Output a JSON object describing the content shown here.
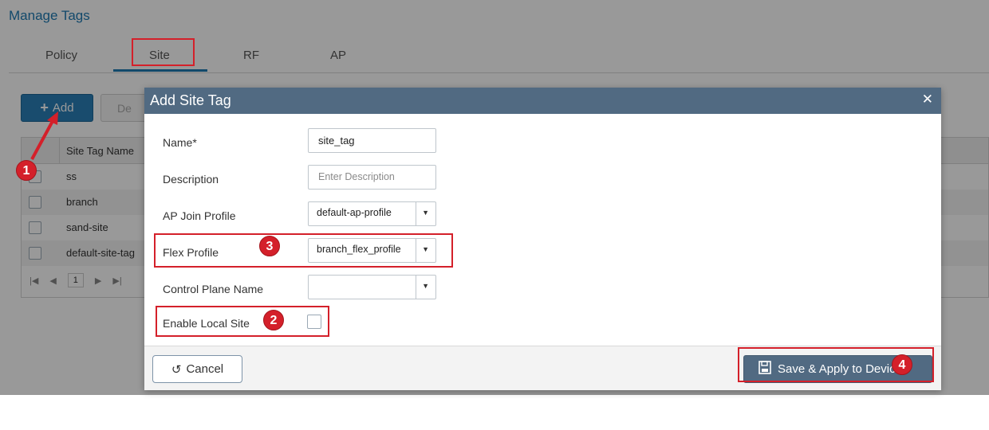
{
  "page": {
    "title": "Manage Tags"
  },
  "tabs": [
    {
      "label": "Policy"
    },
    {
      "label": "Site"
    },
    {
      "label": "RF"
    },
    {
      "label": "AP"
    }
  ],
  "toolbar": {
    "add_label": "Add",
    "delete_label": "De"
  },
  "grid": {
    "column_header": "Site Tag Name",
    "rows": [
      "ss",
      "branch",
      "sand-site",
      "default-site-tag"
    ],
    "current_page": "1"
  },
  "dialog": {
    "title": "Add Site Tag",
    "name": {
      "label": "Name*",
      "value": "site_tag"
    },
    "description": {
      "label": "Description",
      "placeholder": "Enter Description"
    },
    "ap_join_profile": {
      "label": "AP Join Profile",
      "value": "default-ap-profile"
    },
    "flex_profile": {
      "label": "Flex Profile",
      "value": "branch_flex_profile"
    },
    "control_plane_name": {
      "label": "Control Plane Name",
      "value": ""
    },
    "enable_local_site": {
      "label": "Enable Local Site",
      "checked": false
    },
    "cancel_label": "Cancel",
    "save_label": "Save & Apply to Device"
  },
  "annotations": {
    "badges": [
      "1",
      "2",
      "3",
      "4"
    ],
    "color": "#d4202a"
  },
  "colors": {
    "accent": "#1f7ab3",
    "dialog_header": "#516a82",
    "highlight": "#d4202a"
  }
}
